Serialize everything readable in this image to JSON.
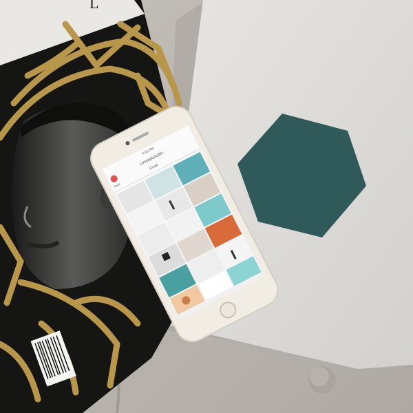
{
  "scene": {
    "description_colors": {
      "couch": "#b8b3ad",
      "white_book": "#dfdeda",
      "hexagon": "#2f5a59",
      "magazine": "#1d1d1b",
      "gold": "#b8964a",
      "phone_frame": "#f2eee6"
    }
  },
  "magazine": {
    "cover_text": "L"
  },
  "phone": {
    "status_time": "4:21 PM",
    "username": "conceptstudio",
    "email_label": "Email",
    "tab_label": "Feed"
  }
}
